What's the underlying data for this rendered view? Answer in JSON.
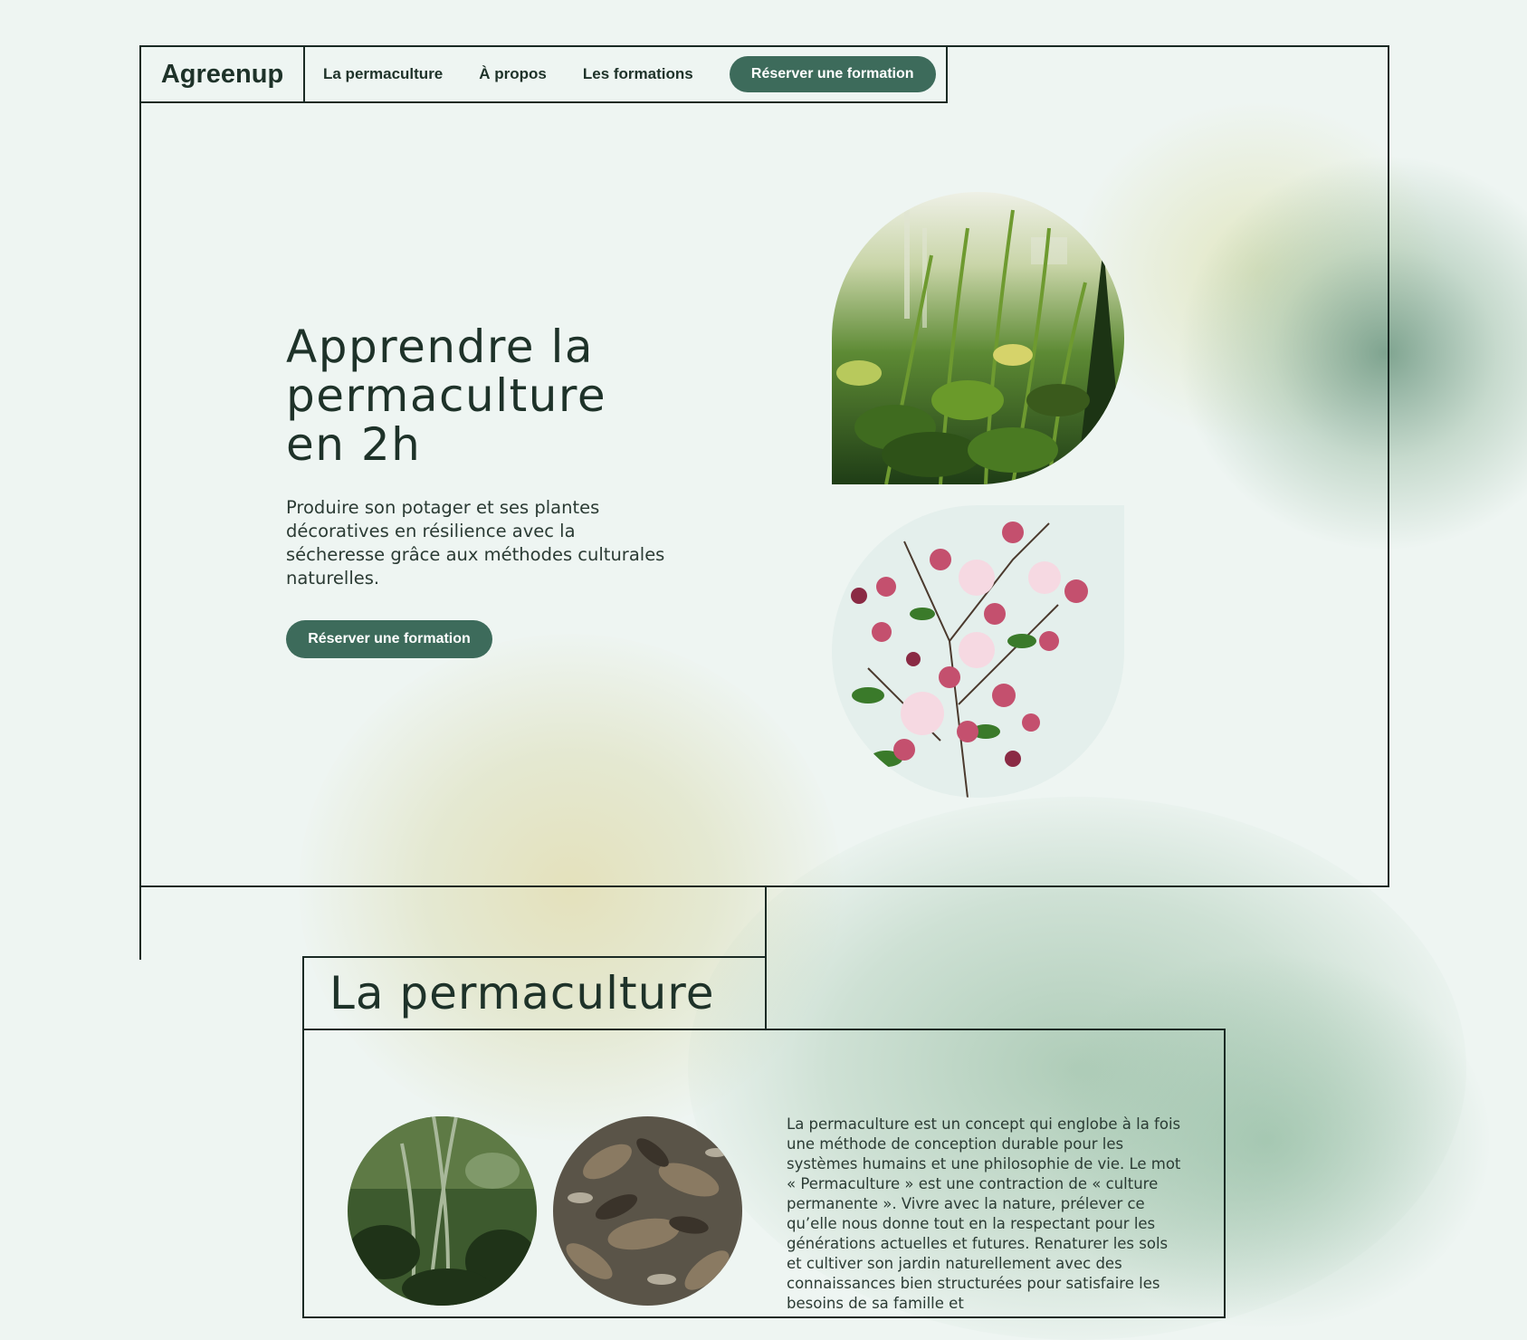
{
  "nav": {
    "logo": "Agreenup",
    "links": [
      "La permaculture",
      "À propos",
      "Les formations"
    ],
    "cta": "Réserver une formation"
  },
  "hero": {
    "title_lines": [
      "Apprendre la",
      "permaculture",
      "en 2h"
    ],
    "subtitle": "Produire son potager et ses plantes décoratives en résilience avec la sécheresse grâce aux méthodes culturales naturelles.",
    "cta": "Réserver une formation",
    "images": [
      "plants-photo",
      "pink-flowers-photo"
    ]
  },
  "section": {
    "title": "La permaculture",
    "body": "La permaculture est un concept qui englobe à la fois une méthode de conception durable pour les systèmes humains et une philosophie de vie. Le mot « Permaculture » est une contraction de « culture permanente ». Vivre avec la nature, prélever ce qu’elle nous donne tout en la respectant pour les générations actuelles et futures. Renaturer les sols et cultiver son jardin naturellement avec des connaissances bien structurées pour satisfaire les besoins de sa famille et",
    "images": [
      "forest-photo",
      "leaf-litter-photo"
    ]
  },
  "colors": {
    "background": "#eef5f2",
    "accent": "#3d6b5b",
    "text": "#1e3229",
    "border": "#1a2a24"
  }
}
